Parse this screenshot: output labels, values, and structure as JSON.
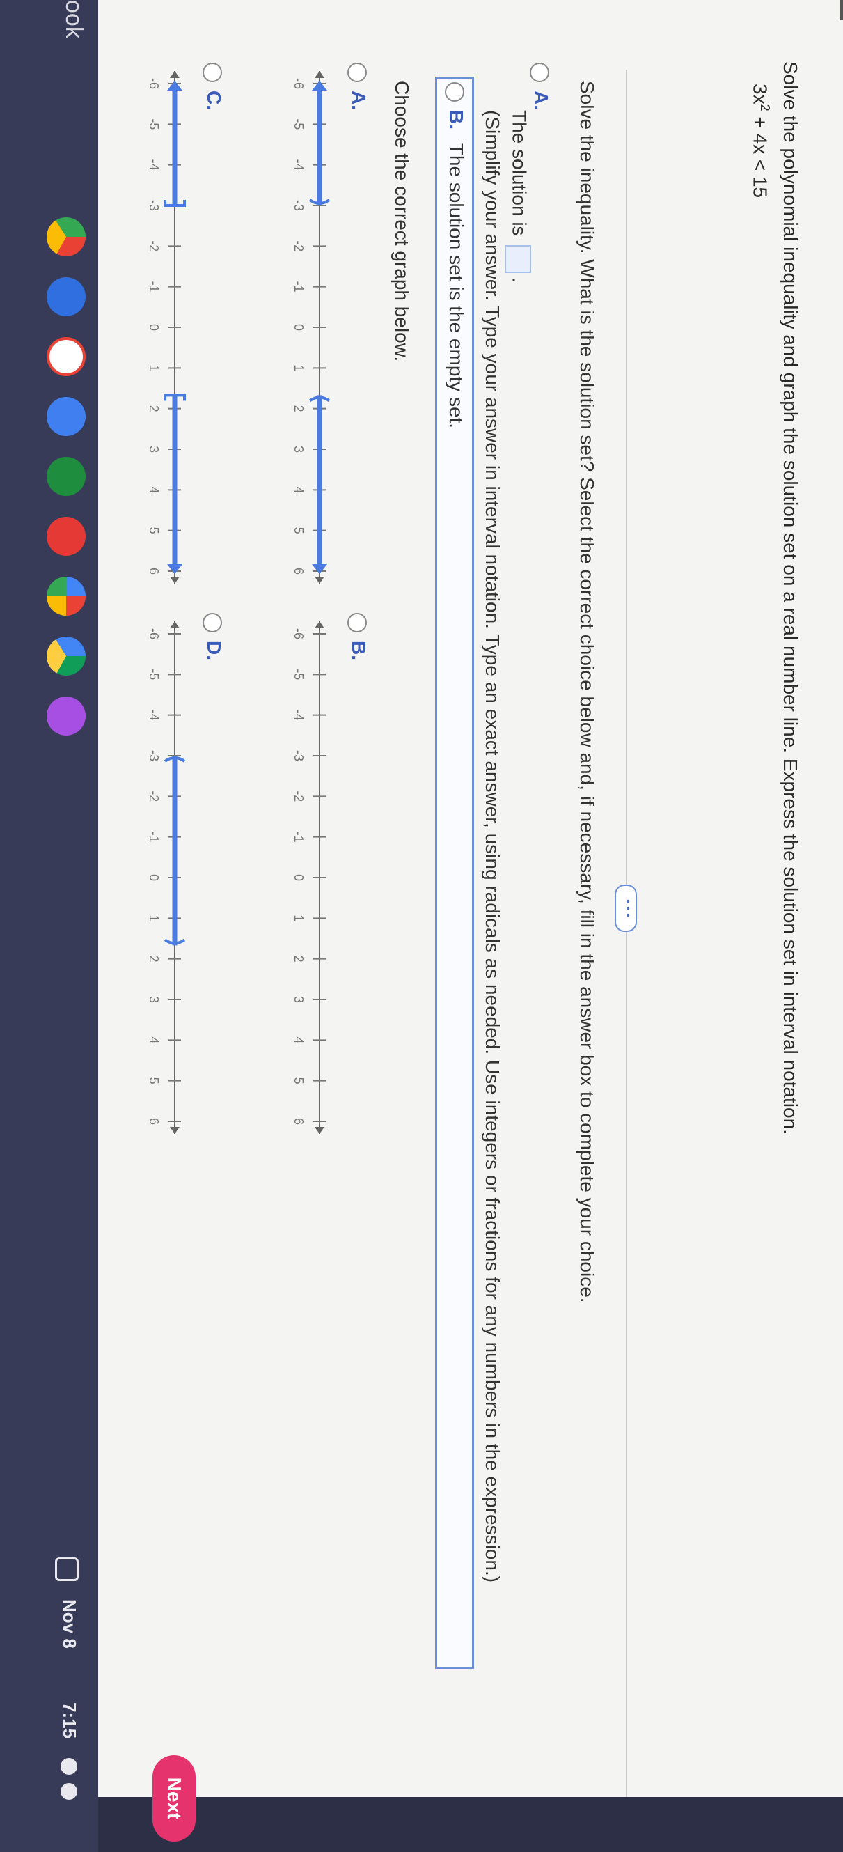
{
  "question": {
    "prompt": "Solve the polynomial inequality and graph the solution set on a real number line. Express the solution set in interval notation.",
    "expr_base": "3x",
    "expr_sup": "2",
    "expr_rest": " + 4x < 15"
  },
  "part1": {
    "instruction": "Solve the inequality. What is the solution set? Select the correct choice below and, if necessary, fill in the answer box to complete your choice.",
    "choice_a_label": "A.",
    "choice_a_text": "The solution is",
    "choice_a_hint": "(Simplify your answer. Type your answer in interval notation. Type an exact answer, using radicals as needed. Use integers or fractions for any numbers in the expression.)",
    "choice_b_label": "B.",
    "choice_b_text": "The solution set is the empty set."
  },
  "part2": {
    "instruction": "Choose the correct graph below.",
    "labels": [
      "A.",
      "B.",
      "C.",
      "D."
    ]
  },
  "chart_data": [
    {
      "type": "number-line",
      "label": "A.",
      "ticks": [
        -6,
        -5,
        -4,
        -3,
        -2,
        -1,
        0,
        1,
        2,
        3,
        4,
        5,
        6
      ],
      "segments": [
        {
          "from": -6,
          "to": -3,
          "left": "arrow",
          "right": "open-paren"
        },
        {
          "from": 1.67,
          "to": 6,
          "left": "open-paren",
          "right": "arrow"
        }
      ]
    },
    {
      "type": "number-line",
      "label": "B.",
      "ticks": [
        -6,
        -5,
        -4,
        -3,
        -2,
        -1,
        0,
        1,
        2,
        3,
        4,
        5,
        6
      ],
      "segments": []
    },
    {
      "type": "number-line",
      "label": "C.",
      "ticks": [
        -6,
        -5,
        -4,
        -3,
        -2,
        -1,
        0,
        1,
        2,
        3,
        4,
        5,
        6
      ],
      "segments": [
        {
          "from": -6,
          "to": -3,
          "left": "arrow",
          "right": "bracket"
        },
        {
          "from": 1.67,
          "to": 6,
          "left": "bracket",
          "right": "arrow"
        }
      ]
    },
    {
      "type": "number-line",
      "label": "D.",
      "ticks": [
        -6,
        -5,
        -4,
        -3,
        -2,
        -1,
        0,
        1,
        2,
        3,
        4,
        5,
        6
      ],
      "segments": [
        {
          "from": -3,
          "to": 1.67,
          "left": "open-paren",
          "right": "open-paren"
        }
      ]
    }
  ],
  "nav": {
    "next_label": "Next",
    "menu_icon": "menu-icon"
  },
  "taskbar": {
    "side_text": "ook",
    "apps": [
      "chrome-icon",
      "files-icon",
      "gmail-icon",
      "calendar-icon",
      "classroom-icon",
      "youtube-icon",
      "photos-icon",
      "drive-icon",
      "keep-icon"
    ],
    "date": "Nov 8",
    "time": "7:15",
    "status_icons": [
      "notification-icon",
      "wifi-icon",
      "battery-icon"
    ]
  },
  "colors": {
    "accent": "#4a7be0",
    "next": "#e4336d",
    "taskbar": "#383b58"
  }
}
